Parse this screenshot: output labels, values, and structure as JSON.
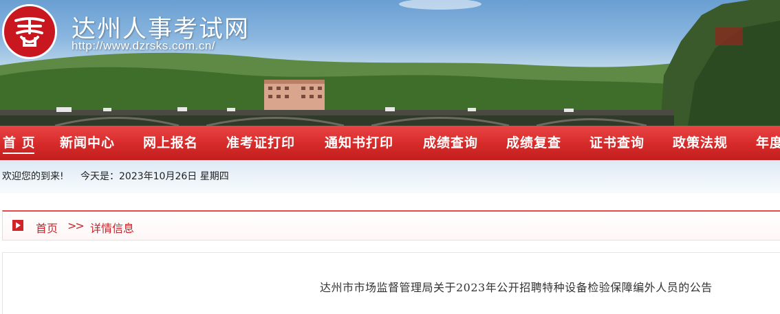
{
  "site": {
    "title": "达州人事考试网",
    "url": "http://www.dzrsks.com.cn/"
  },
  "nav": {
    "items": [
      {
        "label": "首 页",
        "active": true
      },
      {
        "label": "新闻中心"
      },
      {
        "label": "网上报名"
      },
      {
        "label": "准考证打印"
      },
      {
        "label": "通知书打印"
      },
      {
        "label": "成绩查询"
      },
      {
        "label": "成绩复查"
      },
      {
        "label": "证书查询"
      },
      {
        "label": "政策法规"
      },
      {
        "label": "年度"
      }
    ]
  },
  "welcome": {
    "greeting": "欢迎您的到来!",
    "today": "今天是：2023年10月26日 星期四"
  },
  "breadcrumb": {
    "home": "首页",
    "separator": ">>",
    "current": "详情信息"
  },
  "article": {
    "title": "达州市市场监督管理局关于2023年公开招聘特种设备检验保障编外人员的公告"
  },
  "colors": {
    "nav_red": "#d62a2a",
    "brand_red": "#c8232a",
    "logo_red": "#c8171e"
  }
}
